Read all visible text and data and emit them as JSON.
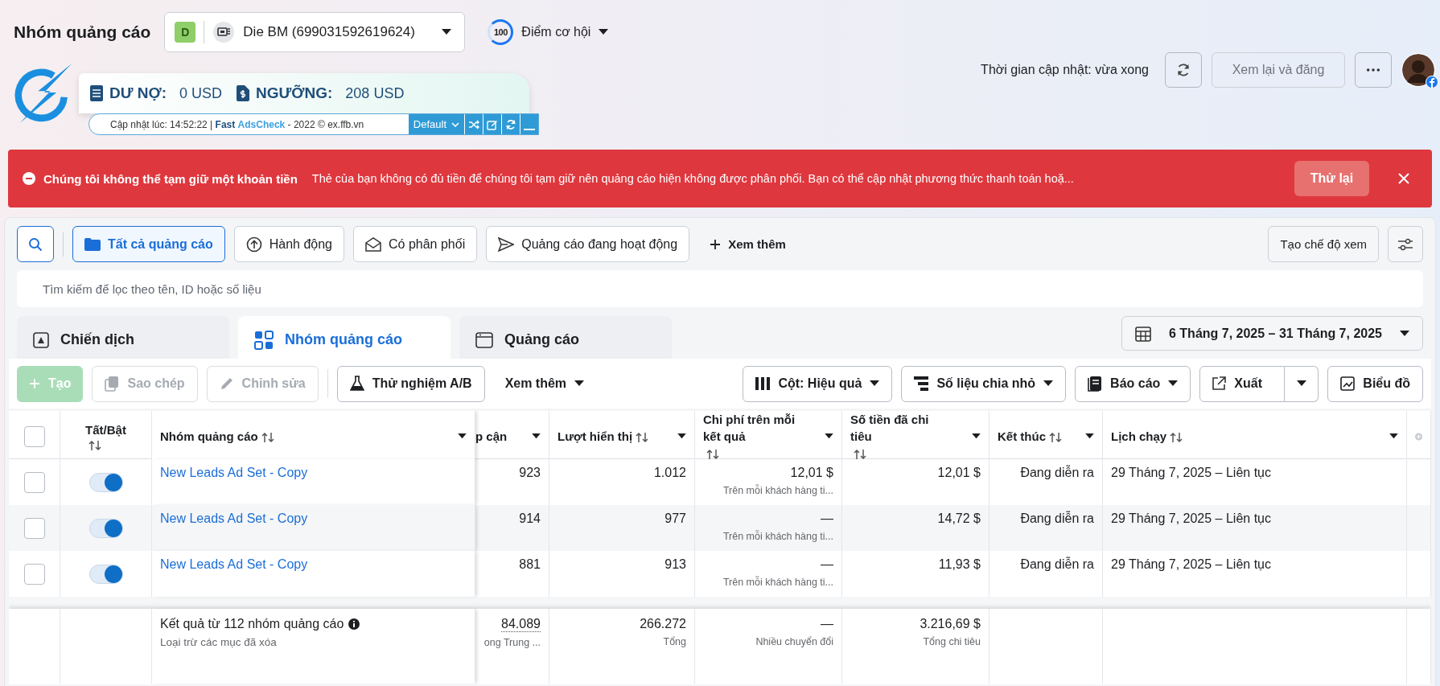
{
  "header": {
    "title": "Nhóm quảng cáo",
    "account": {
      "badge": "D",
      "name": "Die BM (699031592619624)"
    },
    "opportunity": {
      "score": "100",
      "label": "Điểm cơ hội"
    },
    "updated": "Thời gian cập nhật: vừa xong",
    "review_button": {
      "label": "Xem lại và đăng",
      "disabled": true
    }
  },
  "extension": {
    "debt_label": "DƯ NỢ:",
    "debt": "0 USD",
    "threshold_label": "NGƯỠNG:",
    "threshold": "208 USD",
    "update_prefix": "Cập nhật lúc: 14:52:22 |",
    "brand_1": "Fast",
    "brand_2": "AdsCheck",
    "update_suffix": "- 2022 © ex.ffb.vn",
    "preset": "Default"
  },
  "alert": {
    "title": "Chúng tôi không thể tạm giữ một khoản tiền",
    "message": "Thẻ của bạn không có đủ tiền để chúng tôi tạm giữ nên quảng cáo hiện không được phân phối. Bạn có thể cập nhật phương thức thanh toán hoặ...",
    "action": "Thử lại"
  },
  "filters": [
    {
      "label": "Tất cả quảng cáo",
      "selected": true
    },
    {
      "label": "Hành động",
      "selected": false
    },
    {
      "label": "Có phân phối",
      "selected": false
    },
    {
      "label": "Quảng cáo đang hoạt động",
      "selected": false
    }
  ],
  "more_filters": "Xem thêm",
  "view_button": "Tạo chế độ xem",
  "search": {
    "placeholder": "Tìm kiếm để lọc theo tên, ID hoặc số liệu"
  },
  "level_tabs": [
    {
      "label": "Chiến dịch",
      "selected": false
    },
    {
      "label": "Nhóm quảng cáo",
      "selected": true
    },
    {
      "label": "Quảng cáo",
      "selected": false
    }
  ],
  "date_range": "6 Tháng 7, 2025 – 31 Tháng 7, 2025",
  "toolbar": [
    {
      "kind": "create",
      "label": "Tạo",
      "disabled": true
    },
    {
      "kind": "button",
      "label": "Sao chép",
      "disabled": true
    },
    {
      "kind": "button",
      "label": "Chỉnh sửa",
      "disabled": true
    },
    {
      "kind": "button",
      "label": "Thử nghiệm A/B",
      "disabled": false
    },
    {
      "kind": "menu",
      "label": "Xem thêm",
      "disabled": false
    },
    {
      "kind": "dropdown",
      "label": "Cột: Hiệu quả",
      "disabled": false
    },
    {
      "kind": "dropdown",
      "label": "Số liệu chia nhỏ",
      "disabled": false
    },
    {
      "kind": "dropdown",
      "label": "Báo cáo",
      "disabled": false
    },
    {
      "kind": "split",
      "label": "Xuất",
      "disabled": false
    },
    {
      "kind": "button",
      "label": "Biểu đồ",
      "disabled": false
    }
  ],
  "table": {
    "all_checked": false,
    "columns": [
      {
        "label": "Tất/Bật",
        "sortable": true,
        "menu": false
      },
      {
        "label": "Nhóm quảng cáo",
        "sortable": true,
        "menu": true
      },
      {
        "label": "p cận",
        "sortable": false,
        "menu": true
      },
      {
        "label": "Lượt hiển thị",
        "sortable": true,
        "menu": true
      },
      {
        "label": "Chi phí trên mỗi kết quả",
        "sortable": true,
        "menu": true
      },
      {
        "label": "Số tiền đã chi tiêu",
        "sortable": true,
        "menu": true
      },
      {
        "label": "Kết thúc",
        "sortable": true,
        "menu": true
      },
      {
        "label": "Lịch chạy",
        "sortable": true,
        "menu": true
      }
    ],
    "rows": [
      {
        "checked": false,
        "on": true,
        "name": "New Leads Ad Set - Copy",
        "reach": "923",
        "impressions": "1.012",
        "cost": "12,01 $",
        "cost_note": "Trên mỗi khách hàng ti...",
        "spend": "12,01 $",
        "end": "Đang diễn ra",
        "schedule": "29 Tháng 7, 2025 – Liên tục"
      },
      {
        "checked": false,
        "on": true,
        "name": "New Leads Ad Set - Copy",
        "reach": "914",
        "impressions": "977",
        "cost": "—",
        "cost_note": "Trên mỗi khách hàng ti...",
        "spend": "14,72 $",
        "end": "Đang diễn ra",
        "schedule": "29 Tháng 7, 2025 – Liên tục"
      },
      {
        "checked": false,
        "on": true,
        "name": "New Leads Ad Set - Copy",
        "reach": "881",
        "impressions": "913",
        "cost": "—",
        "cost_note": "Trên mỗi khách hàng ti...",
        "spend": "11,93 $",
        "end": "Đang diễn ra",
        "schedule": "29 Tháng 7, 2025 – Liên tục"
      }
    ],
    "footer": {
      "title": "Kết quả từ 112 nhóm quảng cáo",
      "note": "Loại trừ các mục đã xóa",
      "reach": "84.089",
      "reach_note": "ong Trung ...",
      "impressions": "266.272",
      "impressions_note": "Tổng",
      "cost": "—",
      "cost_note": "Nhiều chuyển đổi",
      "spend": "3.216,69 $",
      "spend_note": "Tổng chi tiêu"
    }
  }
}
